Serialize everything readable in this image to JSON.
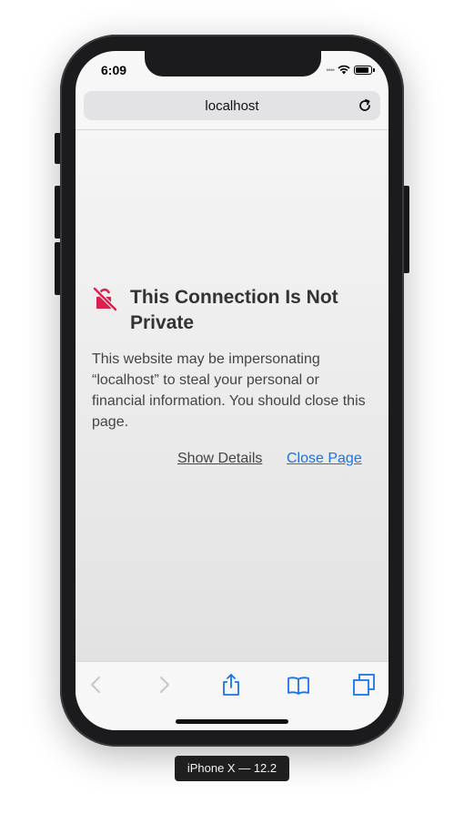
{
  "status_bar": {
    "time": "6:09"
  },
  "address_bar": {
    "url": "localhost"
  },
  "warning": {
    "title": "This Connection Is Not Private",
    "body": "This website may be impersonating “localhost” to steal your personal or financial information. You should close this page.",
    "show_details_label": "Show Details",
    "close_page_label": "Close Page"
  },
  "toolbar": {
    "icons": [
      "back-icon",
      "forward-icon",
      "share-icon",
      "bookmarks-icon",
      "tabs-icon"
    ]
  },
  "device_label": "iPhone X — 12.2",
  "colors": {
    "link": "#1a73e8",
    "warning_icon": "#d9214e",
    "toolbar_icon": "#1a73e8",
    "disabled_icon": "#c7c7cc"
  }
}
